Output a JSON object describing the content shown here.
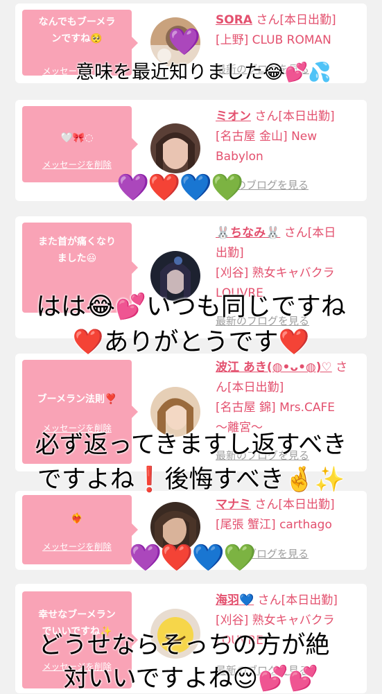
{
  "common": {
    "delete_label": "メッセージを削除",
    "blog_label": "最新のブログを見る"
  },
  "cards": [
    {
      "message": "なんでもブーメラ\nンですね🥺",
      "name": "SORA",
      "info": " さん[本日出勤]\n[上野] CLUB ROMAN",
      "blog_partial": "最新のブログを見る"
    },
    {
      "message": "🤍🎀◌",
      "name": "ミオン",
      "info": " さん[本日出勤]\n[名古屋 金山] New\nBabylon",
      "blog_partial": "のブログを見る"
    },
    {
      "message": "また首が痛くなり\nました😃",
      "name": "🐰ちなみ🐰",
      "info": " さん[本日\n出勤]\n[刈谷] 熟女キャバクラ\nLOUVRE",
      "blog_partial": "最新のブログを見る"
    },
    {
      "message": "ブーメラン法則❣️",
      "name": "波江 あき(◍•ᴗ•◍)♡",
      "info": " さ\nん[本日出勤]\n[名古屋 錦] Mrs.CAFE\n〜離宮〜",
      "blog_partial": "最新のブログを見る"
    },
    {
      "message": "❤️‍🔥",
      "name": "マナミ",
      "info": " さん[本日出勤]\n[尾張 蟹江] carthago",
      "blog_partial": "のブログを見る"
    },
    {
      "message": "幸せなブーメラン\nでいいですね✨",
      "name": "海羽💙",
      "info": " さん[本日出勤]\n[刈谷] 熟女キャバクラ\nLOUVRE",
      "blog_partial": "最新のブログを見る"
    }
  ],
  "overlays": {
    "o1": "意味を最近知りました😂💕💦",
    "o2a": "はは😂💕いつも同じですね",
    "o2b": "❤️ありがとうです❤️",
    "o3a": "必ず返ってきますし返すべき",
    "o3b": "ですよね❗️後悔すべき🤞✨",
    "o4a": "どうせならそっちの方が絶",
    "o4b": "対いいですよね😌💕💕",
    "hearts": "💜❤️💙💚"
  },
  "colors": {
    "bubble": "#f9a3b6",
    "name": "#e3506e",
    "background": "#f1f1f1"
  }
}
